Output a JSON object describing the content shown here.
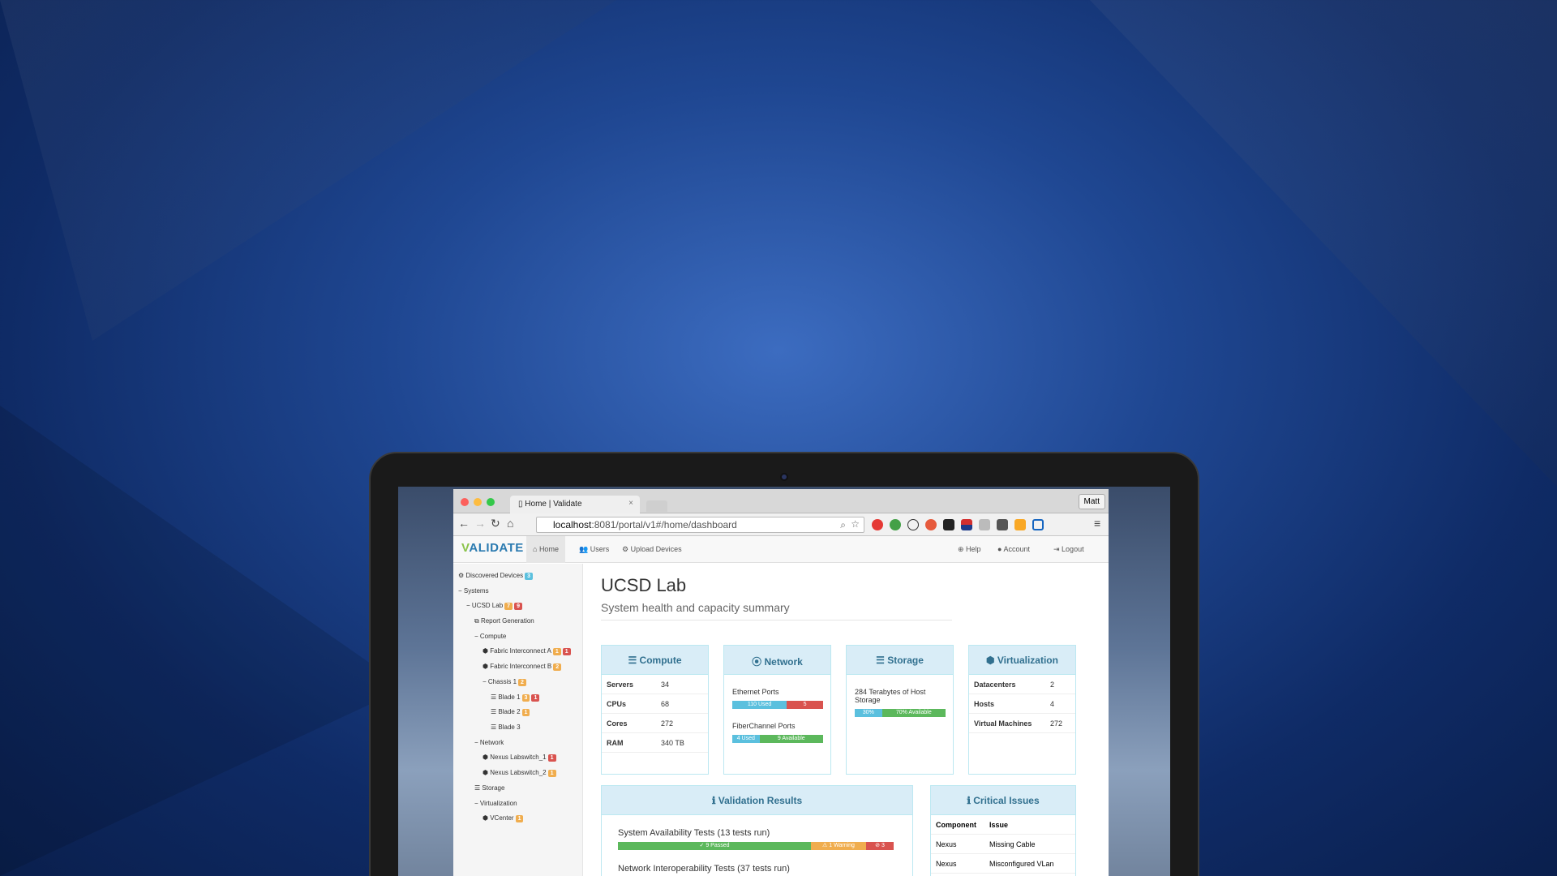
{
  "browser": {
    "tab_title": "Home | Validate",
    "tab_close": "×",
    "profile_name": "Matt",
    "url_host": "localhost",
    "url_rest": ":8081/portal/v1#/home/dashboard"
  },
  "app": {
    "logo_v": "V",
    "logo_rest": "ALIDATE",
    "nav": {
      "home": "Home",
      "users": "Users",
      "upload": "Upload Devices",
      "help": "Help",
      "account": "Account",
      "logout": "Logout"
    }
  },
  "sidebar": {
    "discovered_label": "Discovered Devices",
    "discovered_count": "3",
    "systems": "Systems",
    "ucsd_lab": "UCSD Lab",
    "ucsd_warn": "7",
    "ucsd_err": "9",
    "report": "Report Generation",
    "compute": "Compute",
    "fi_a": "Fabric Interconnect A",
    "fi_a_warn": "1",
    "fi_a_err": "1",
    "fi_b": "Fabric Interconnect B",
    "fi_b_warn": "2",
    "chassis": "Chassis 1",
    "chassis_warn": "2",
    "blade1": "Blade 1",
    "blade1_warn": "3",
    "blade1_err": "1",
    "blade2": "Blade 2",
    "blade2_warn": "1",
    "blade3": "Blade 3",
    "network": "Network",
    "nexus1": "Nexus Labswitch_1",
    "nexus1_err": "1",
    "nexus2": "Nexus Labswitch_2",
    "nexus2_warn": "1",
    "storage": "Storage",
    "virtualization": "Virtualization",
    "vcenter": "VCenter",
    "vcenter_warn": "1"
  },
  "main": {
    "title": "UCSD Lab",
    "subtitle": "System health and capacity summary",
    "compute": {
      "title": "Compute",
      "rows": [
        {
          "k": "Servers",
          "v": "34"
        },
        {
          "k": "CPUs",
          "v": "68"
        },
        {
          "k": "Cores",
          "v": "272"
        },
        {
          "k": "RAM",
          "v": "340 TB"
        }
      ]
    },
    "network": {
      "title": "Network",
      "eth_label": "Ethernet Ports",
      "eth_used_label": "110 Used",
      "eth_other": "5",
      "eth_used_fraction": 0.6,
      "fc_label": "FiberChannel Ports",
      "fc_used_label": "4 Used",
      "fc_avail_label": "9 Available",
      "fc_used_fraction": 0.3
    },
    "storage": {
      "title": "Storage",
      "label": "284 Terabytes of Host Storage",
      "used_label": "30%",
      "avail_label": "70% Available",
      "used_fraction": 0.3
    },
    "virtualization": {
      "title": "Virtualization",
      "rows": [
        {
          "k": "Datacenters",
          "v": "2"
        },
        {
          "k": "Hosts",
          "v": "4"
        },
        {
          "k": "Virtual Machines",
          "v": "272"
        }
      ]
    },
    "validation": {
      "title": "Validation Results",
      "test1_title": "System Availability Tests (13 tests run)",
      "passed_label": "9 Passed",
      "warning_label": "1 Warning",
      "failed_label": "3",
      "passed_fraction": 0.7,
      "warning_fraction": 0.2,
      "failed_fraction": 0.1,
      "test2_title": "Network Interoperability Tests (37 tests run)"
    },
    "critical": {
      "title": "Critical Issues",
      "col_component": "Component",
      "col_issue": "Issue",
      "rows": [
        {
          "component": "Nexus",
          "issue": "Missing Cable"
        },
        {
          "component": "Nexus",
          "issue": "Misconfigured VLan"
        }
      ]
    }
  },
  "colors": {
    "background": "#1f4792",
    "accent": "#31708f",
    "info": "#5bc0de",
    "success": "#5cb85c",
    "warning": "#f0ad4e",
    "danger": "#d9534f"
  }
}
